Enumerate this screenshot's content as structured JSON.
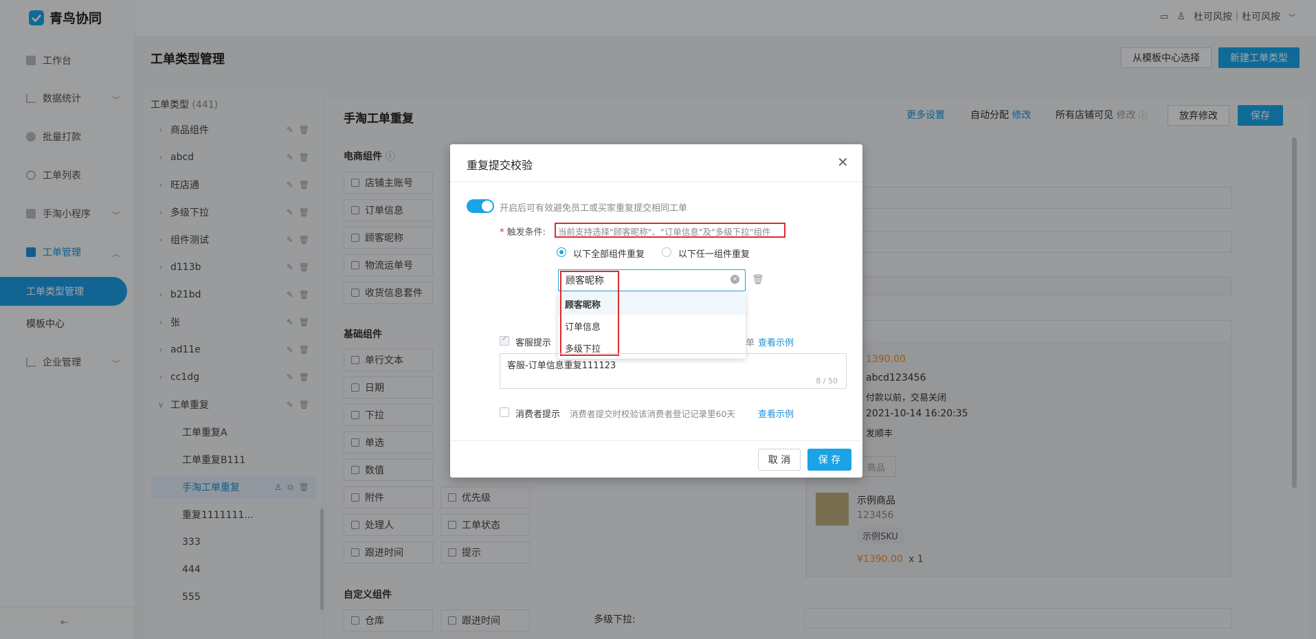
{
  "app": {
    "logo_text": "青鸟协同",
    "user": "杜可风按｜杜可风按"
  },
  "sidebar": {
    "items": [
      {
        "label": "工作台",
        "icon": "monitor-icon"
      },
      {
        "label": "数据统计",
        "icon": "bar-chart-icon",
        "expandable": true
      },
      {
        "label": "批量打款",
        "icon": "coin-icon"
      },
      {
        "label": "工单列表",
        "icon": "search-list-icon"
      },
      {
        "label": "手淘小程序",
        "icon": "bag-icon",
        "expandable": true
      },
      {
        "label": "工单管理",
        "icon": "doc-edit-icon",
        "expanded": true
      },
      {
        "label": "企业管理",
        "icon": "chart-icon",
        "expandable": true
      }
    ],
    "sub_items": [
      "工单类型管理",
      "模板中心"
    ]
  },
  "header": {
    "title": "工单类型管理",
    "btn_template": "从模板中心选择",
    "btn_new": "新建工单类型"
  },
  "tree": {
    "heading": "工单类型",
    "count": "(441)",
    "items": [
      "商品组件",
      "abcd",
      "旺店通",
      "多级下拉",
      "组件测试",
      "d113b",
      "b21bd",
      "张",
      "ad11e",
      "cc1dg",
      "工单重复"
    ],
    "children": [
      "工单重复A",
      "工单重复B111",
      "手淘工单重复",
      "重复1111111...",
      "333",
      "444",
      "555"
    ]
  },
  "editor": {
    "title": "手淘工单重复",
    "more_settings": "更多设置",
    "auto_assign": "自动分配",
    "auto_assign_edit": "修改",
    "visible": "所有店铺可见",
    "visible_edit": "修改",
    "discard": "放弃修改",
    "save": "保存"
  },
  "components": {
    "ecommerce_title": "电商组件",
    "ecommerce": [
      "店铺主账号",
      "订单信息",
      "顾客昵称",
      "物流运单号",
      "收货信息套件"
    ],
    "basic_title": "基础组件",
    "basic_left": [
      "单行文本",
      "日期",
      "下拉",
      "单选",
      "数值",
      "附件",
      "处理人",
      "跟进时间"
    ],
    "basic_right": [
      "优先级",
      "工单状态",
      "提示"
    ],
    "custom_title": "自定义组件",
    "custom": [
      "仓库",
      "跟进时间"
    ]
  },
  "preview": {
    "price": "1390.00",
    "order_id": "abcd123456",
    "status": "付款以前，交易关闭",
    "time": "2021-10-14 16:20:35",
    "shipping": "发顺丰",
    "product_name": "示例商品",
    "product_code": "123456",
    "sku": "示例SKU",
    "product_price": "¥1390.00",
    "qty": "x 1",
    "multi_label": "多级下拉:",
    "add_goods": "商品"
  },
  "dialog": {
    "title": "重复提交校验",
    "toggle_text": "开启后可有效避免员工或买家重复提交相同工单",
    "trigger_label": "触发条件:",
    "trigger_hint": "当前支持选择\"顾客昵称\"、\"订单信息\"及\"多级下拉\"组件",
    "radio_all": "以下全部组件重复",
    "radio_any": "以下任一组件重复",
    "select_value": "顾客昵称",
    "options": [
      "顾客昵称",
      "订单信息",
      "多级下拉"
    ],
    "cs_label": "客服提示",
    "cs_hint_tail": "单",
    "view_example": "查看示例",
    "textarea_value": "客服-订单信息重复111123",
    "counter": "8 / 50",
    "consumer_label": "消费者提示",
    "consumer_hint": "消费者提交时校验该消费者登记记录里60天",
    "cancel": "取 消",
    "save": "保 存"
  },
  "colors": {
    "accent": "#1aa3e6",
    "highlight": "#e0282e",
    "price": "#f08a24"
  }
}
